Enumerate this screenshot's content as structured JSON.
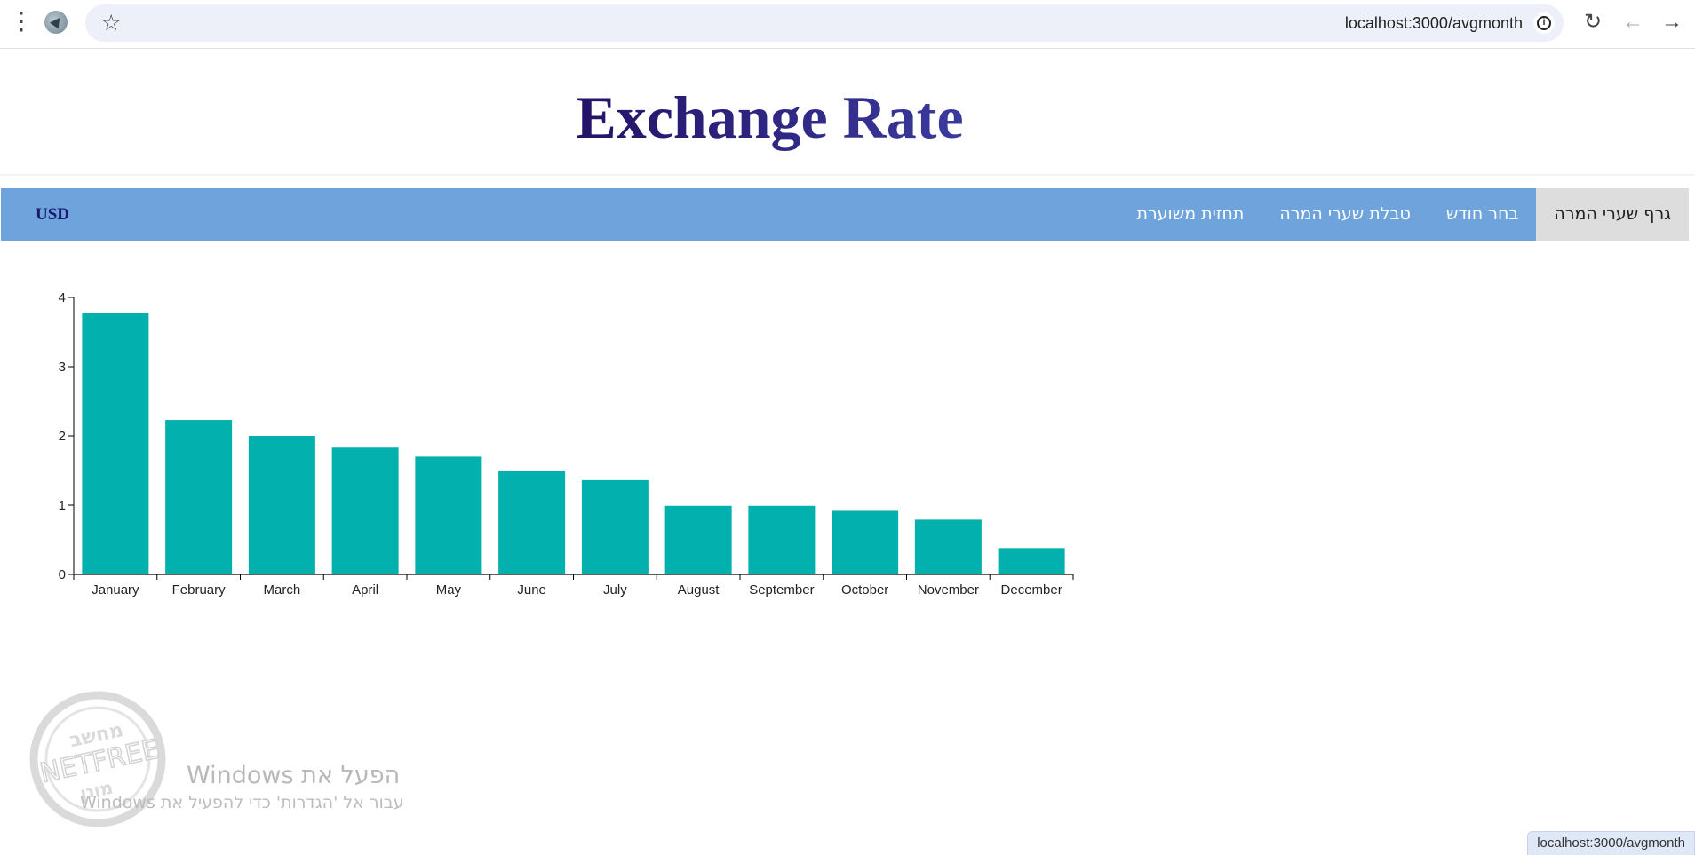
{
  "browser": {
    "url": "localhost:3000/avgmonth",
    "menu_icon": "kebab-menu-icon",
    "extension_icon": "netfree-extension-icon",
    "bookmark_icon": "star-icon",
    "info_icon": "info-icon",
    "nav_icons": [
      "reload-icon",
      "back-icon",
      "forward-icon"
    ]
  },
  "page": {
    "title": "Exchange Rate",
    "title_colors": [
      "#241266",
      "#3a3a9e"
    ]
  },
  "navbar": {
    "background": "#6fa3dc",
    "items": [
      {
        "label": "גרף שערי המרה",
        "active": true
      },
      {
        "label": "בחר חודש",
        "active": false
      },
      {
        "label": "טבלת שערי המרה",
        "active": false
      },
      {
        "label": "תחזית משוערת",
        "active": false
      }
    ],
    "currency": "USD"
  },
  "chart_data": {
    "type": "bar",
    "categories": [
      "January",
      "February",
      "March",
      "April",
      "May",
      "June",
      "July",
      "August",
      "September",
      "October",
      "November",
      "December"
    ],
    "values": [
      3.78,
      2.23,
      2.0,
      1.83,
      1.7,
      1.5,
      1.36,
      0.99,
      0.99,
      0.93,
      0.79,
      0.38
    ],
    "ylim": [
      0,
      4
    ],
    "yticks": [
      "0",
      "1",
      "2",
      "3",
      "4"
    ],
    "bar_color": "#02b0ad",
    "title": "",
    "xlabel": "",
    "ylabel": "",
    "grid": false,
    "legend": "none"
  },
  "watermark": {
    "seal_top": "מחשב",
    "seal_middle": "NETFREE",
    "seal_bottom": "מוגן",
    "activate_title": "הפעל את Windows",
    "activate_sub": "עבור אל 'הגדרות' כדי להפעיל את Windows"
  },
  "status_bar": {
    "url": "localhost:3000/avgmonth"
  }
}
